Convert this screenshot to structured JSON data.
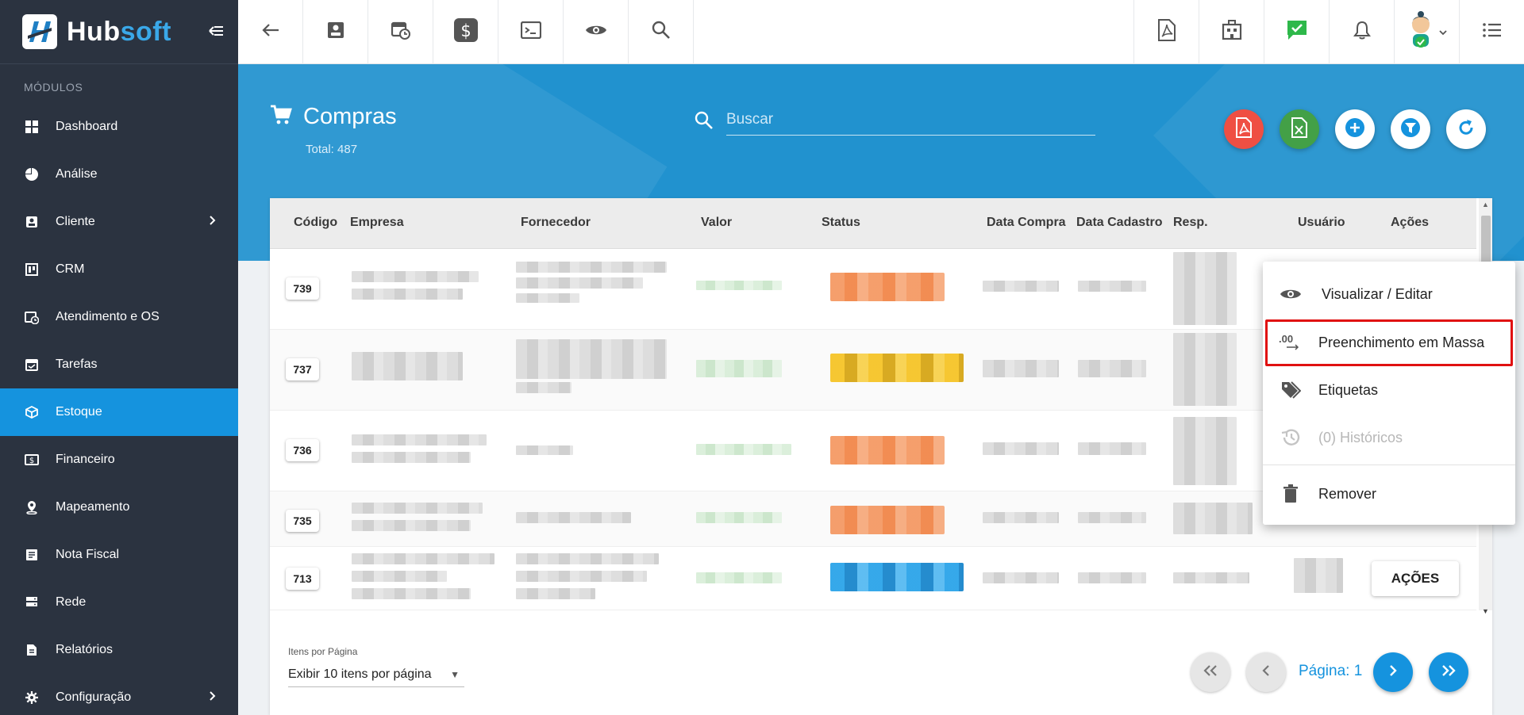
{
  "brand": {
    "part1": "Hub",
    "part2": "soft"
  },
  "sidebar": {
    "section_title": "MÓDULOS",
    "items": [
      {
        "label": "Dashboard",
        "icon": "dashboard-icon"
      },
      {
        "label": "Análise",
        "icon": "pie-chart-icon"
      },
      {
        "label": "Cliente",
        "icon": "contact-card-icon",
        "has_submenu": true
      },
      {
        "label": "CRM",
        "icon": "board-icon"
      },
      {
        "label": "Atendimento e OS",
        "icon": "calendar-clock-icon"
      },
      {
        "label": "Tarefas",
        "icon": "calendar-check-icon"
      },
      {
        "label": "Estoque",
        "icon": "box-icon",
        "active": true
      },
      {
        "label": "Financeiro",
        "icon": "cash-icon"
      },
      {
        "label": "Mapeamento",
        "icon": "map-pin-icon"
      },
      {
        "label": "Nota Fiscal",
        "icon": "document-icon"
      },
      {
        "label": "Rede",
        "icon": "server-icon"
      },
      {
        "label": "Relatórios",
        "icon": "report-icon"
      },
      {
        "label": "Configuração",
        "icon": "gear-icon",
        "has_submenu": true
      }
    ]
  },
  "topbar": {
    "left_icons": [
      "back-arrow-icon",
      "contact-card-icon",
      "calendar-clock-icon",
      "dollar-icon",
      "terminal-icon",
      "eye-icon",
      "search-icon"
    ],
    "right_icons": [
      "pdf-icon",
      "building-icon",
      "checked-message-icon",
      "bell-icon",
      "avatar",
      "list-menu-icon"
    ]
  },
  "page": {
    "title": "Compras",
    "total": "Total: 487",
    "search_placeholder": "Buscar"
  },
  "hero_actions": [
    {
      "icon": "pdf-icon",
      "color": "#ef4f43"
    },
    {
      "icon": "excel-icon",
      "color": "#43a047"
    },
    {
      "icon": "plus-icon",
      "color": "#ffffff"
    },
    {
      "icon": "filter-icon",
      "color": "#ffffff"
    },
    {
      "icon": "refresh-icon",
      "color": "#ffffff"
    }
  ],
  "table": {
    "columns": [
      "Código",
      "Empresa",
      "Fornecedor",
      "Valor",
      "Status",
      "Data Compra",
      "Data Cadastro",
      "Resp.",
      "Usuário",
      "Ações"
    ],
    "rows": [
      {
        "code": "739",
        "status_color": "#f08040"
      },
      {
        "code": "737",
        "status_color": "#f5c11c"
      },
      {
        "code": "736",
        "status_color": "#f08040"
      },
      {
        "code": "735",
        "status_color": "#f08040"
      },
      {
        "code": "713",
        "status_color": "#1f9fe8",
        "action_label": "AÇÕES"
      }
    ]
  },
  "context_menu": {
    "items": [
      {
        "label": "Visualizar / Editar",
        "icon": "eye-icon"
      },
      {
        "label": "Preenchimento em Massa",
        "icon": "bulk-fill-icon",
        "highlighted": true
      },
      {
        "label": "Etiquetas",
        "icon": "tags-icon"
      },
      {
        "label": "(0) Históricos",
        "icon": "history-icon",
        "disabled": true
      },
      {
        "label": "Remover",
        "icon": "trash-icon"
      }
    ],
    "bulk_icon_text": ".00"
  },
  "pagination": {
    "per_page_label": "Itens por Página",
    "per_page_value": "Exibir 10 itens por página",
    "page_label": "Página: 1"
  },
  "colors": {
    "primary": "#1593de",
    "sidebar_bg": "#2b3340",
    "highlight": "#e01010"
  }
}
